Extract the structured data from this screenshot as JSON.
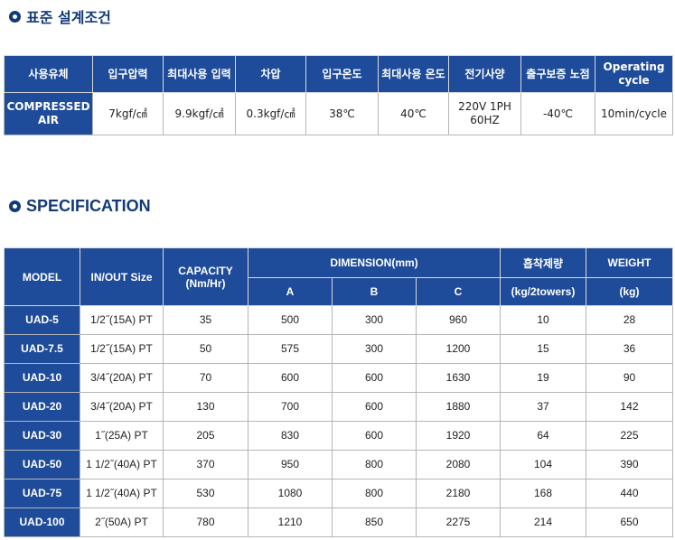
{
  "section1": {
    "title": "표준 설계조건"
  },
  "design_conditions": {
    "headers": [
      "사용유체",
      "입구압력",
      "최대사용 입력",
      "차압",
      "입구온도",
      "최대사용 온도",
      "전기사양",
      "출구보증 노점",
      "Operating cycle"
    ],
    "values": [
      "COMPRESSED AIR",
      "7kgf/㎠",
      "9.9kgf/㎠",
      "0.3kgf/㎠",
      "38℃",
      "40℃",
      "220V 1PH 60HZ",
      "-40℃",
      "10min/cycle"
    ]
  },
  "section2": {
    "title": "SPECIFICATION"
  },
  "specification": {
    "headers": {
      "model": "MODEL",
      "inout": "IN/OUT Size",
      "capacity": "CAPACITY (Nm/Hr)",
      "dimension": "DIMENSION(mm)",
      "dim_a": "A",
      "dim_b": "B",
      "dim_c": "C",
      "absorbent": "흡착제량",
      "absorbent_unit": "(kg/2towers)",
      "weight": "WEIGHT",
      "weight_unit": "(kg)"
    },
    "rows": [
      {
        "model": "UAD-5",
        "inout": "1/2˝(15A) PT",
        "capacity": "35",
        "a": "500",
        "b": "300",
        "c": "960",
        "absorbent": "10",
        "weight": "28"
      },
      {
        "model": "UAD-7.5",
        "inout": "1/2˝(15A) PT",
        "capacity": "50",
        "a": "575",
        "b": "300",
        "c": "1200",
        "absorbent": "15",
        "weight": "36"
      },
      {
        "model": "UAD-10",
        "inout": "3/4˝(20A) PT",
        "capacity": "70",
        "a": "600",
        "b": "600",
        "c": "1630",
        "absorbent": "19",
        "weight": "90"
      },
      {
        "model": "UAD-20",
        "inout": "3/4˝(20A) PT",
        "capacity": "130",
        "a": "700",
        "b": "600",
        "c": "1880",
        "absorbent": "37",
        "weight": "142"
      },
      {
        "model": "UAD-30",
        "inout": "1˝(25A) PT",
        "capacity": "205",
        "a": "830",
        "b": "600",
        "c": "1920",
        "absorbent": "64",
        "weight": "225"
      },
      {
        "model": "UAD-50",
        "inout": "1 1/2˝(40A) PT",
        "capacity": "370",
        "a": "950",
        "b": "800",
        "c": "2080",
        "absorbent": "104",
        "weight": "390"
      },
      {
        "model": "UAD-75",
        "inout": "1 1/2˝(40A) PT",
        "capacity": "530",
        "a": "1080",
        "b": "800",
        "c": "2180",
        "absorbent": "168",
        "weight": "440"
      },
      {
        "model": "UAD-100",
        "inout": "2˝(50A) PT",
        "capacity": "780",
        "a": "1210",
        "b": "850",
        "c": "2275",
        "absorbent": "214",
        "weight": "650"
      }
    ]
  },
  "colors": {
    "header_bg": "#1f4c9a",
    "title": "#123a78"
  },
  "icons": {
    "section_bullet": "circle-bullet-icon"
  }
}
